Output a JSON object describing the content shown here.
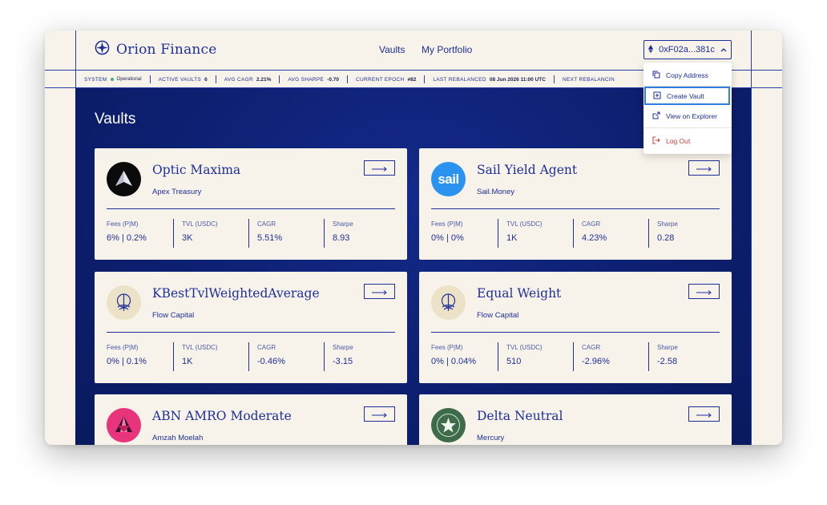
{
  "app": {
    "name": "Orion Finance"
  },
  "nav": {
    "vaults": "Vaults",
    "portfolio": "My Portfolio"
  },
  "wallet": {
    "address": "0xF02a...381c"
  },
  "stats": [
    {
      "label": "SYSTEM",
      "value": "Operational"
    },
    {
      "label": "ACTIVE VAULTS",
      "value": "6"
    },
    {
      "label": "AVG CAGR",
      "value": "2.21%"
    },
    {
      "label": "AVG SHARPE",
      "value": "-0.70"
    },
    {
      "label": "CURRENT EPOCH",
      "value": "#82"
    },
    {
      "label": "LAST REBALANCED",
      "value": "08 Jun 2026 11:00 UTC"
    },
    {
      "label": "NEXT REBALANCIN",
      "value": ""
    }
  ],
  "menu": {
    "copy": "Copy Address",
    "create": "Create Vault",
    "explorer": "View on Explorer",
    "logout": "Log Out"
  },
  "page": {
    "title": "Vaults"
  },
  "metric_labels": {
    "fees": "Fees (P|M)",
    "tvl": "TVL (USDC)",
    "cagr": "CAGR",
    "sharpe": "Sharpe"
  },
  "vaults": [
    {
      "name": "Optic Maxima",
      "manager": "Apex Treasury",
      "fees": "6% | 0.2%",
      "tvl": "3K",
      "cagr": "5.51%",
      "sharpe": "8.93",
      "avatar": "mountain-logo-icon"
    },
    {
      "name": "Sail Yield Agent",
      "manager": "Sail.Money",
      "fees": "0% | 0%",
      "tvl": "1K",
      "cagr": "4.23%",
      "sharpe": "0.28",
      "avatar": "sail-logo-icon",
      "avatar_text": "sail"
    },
    {
      "name": "KBestTvlWeightedAverage",
      "manager": "Flow Capital",
      "fees": "0% | 0.1%",
      "tvl": "1K",
      "cagr": "-0.46%",
      "sharpe": "-3.15",
      "avatar": "flow-tree-logo-icon"
    },
    {
      "name": "Equal Weight",
      "manager": "Flow Capital",
      "fees": "0% | 0.04%",
      "tvl": "510",
      "cagr": "-2.96%",
      "sharpe": "-2.58",
      "avatar": "flow-tree-logo-icon"
    },
    {
      "name": "ABN AMRO Moderate",
      "manager": "Amzah Moelah",
      "avatar": "origami-logo-icon"
    },
    {
      "name": "Delta Neutral",
      "manager": "Mercury",
      "avatar": "star-logo-icon"
    }
  ],
  "colors": {
    "brand": "#1e2f9a",
    "background": "#f7f3ea",
    "main_bg": "#0c1f70",
    "highlight": "#2f7de0",
    "danger": "#d23b3b",
    "status_ok": "#3bb273"
  }
}
